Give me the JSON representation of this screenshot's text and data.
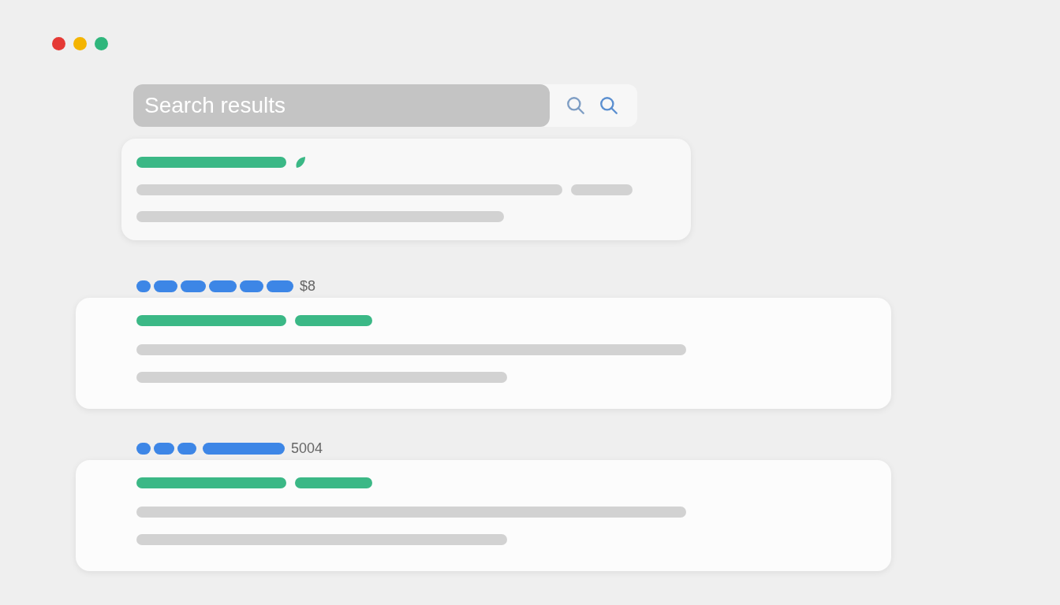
{
  "window": {
    "controls": [
      {
        "color": "#e53935"
      },
      {
        "color": "#f4b400"
      },
      {
        "color": "#2fb67c"
      }
    ]
  },
  "search": {
    "value": "Search results"
  },
  "results": [
    {
      "kind": "featured"
    },
    {
      "kind": "standard",
      "meta": {
        "kind": "dots",
        "label": "$8"
      }
    },
    {
      "kind": "standard",
      "meta": {
        "kind": "dots-bar",
        "label": "5004"
      }
    }
  ]
}
